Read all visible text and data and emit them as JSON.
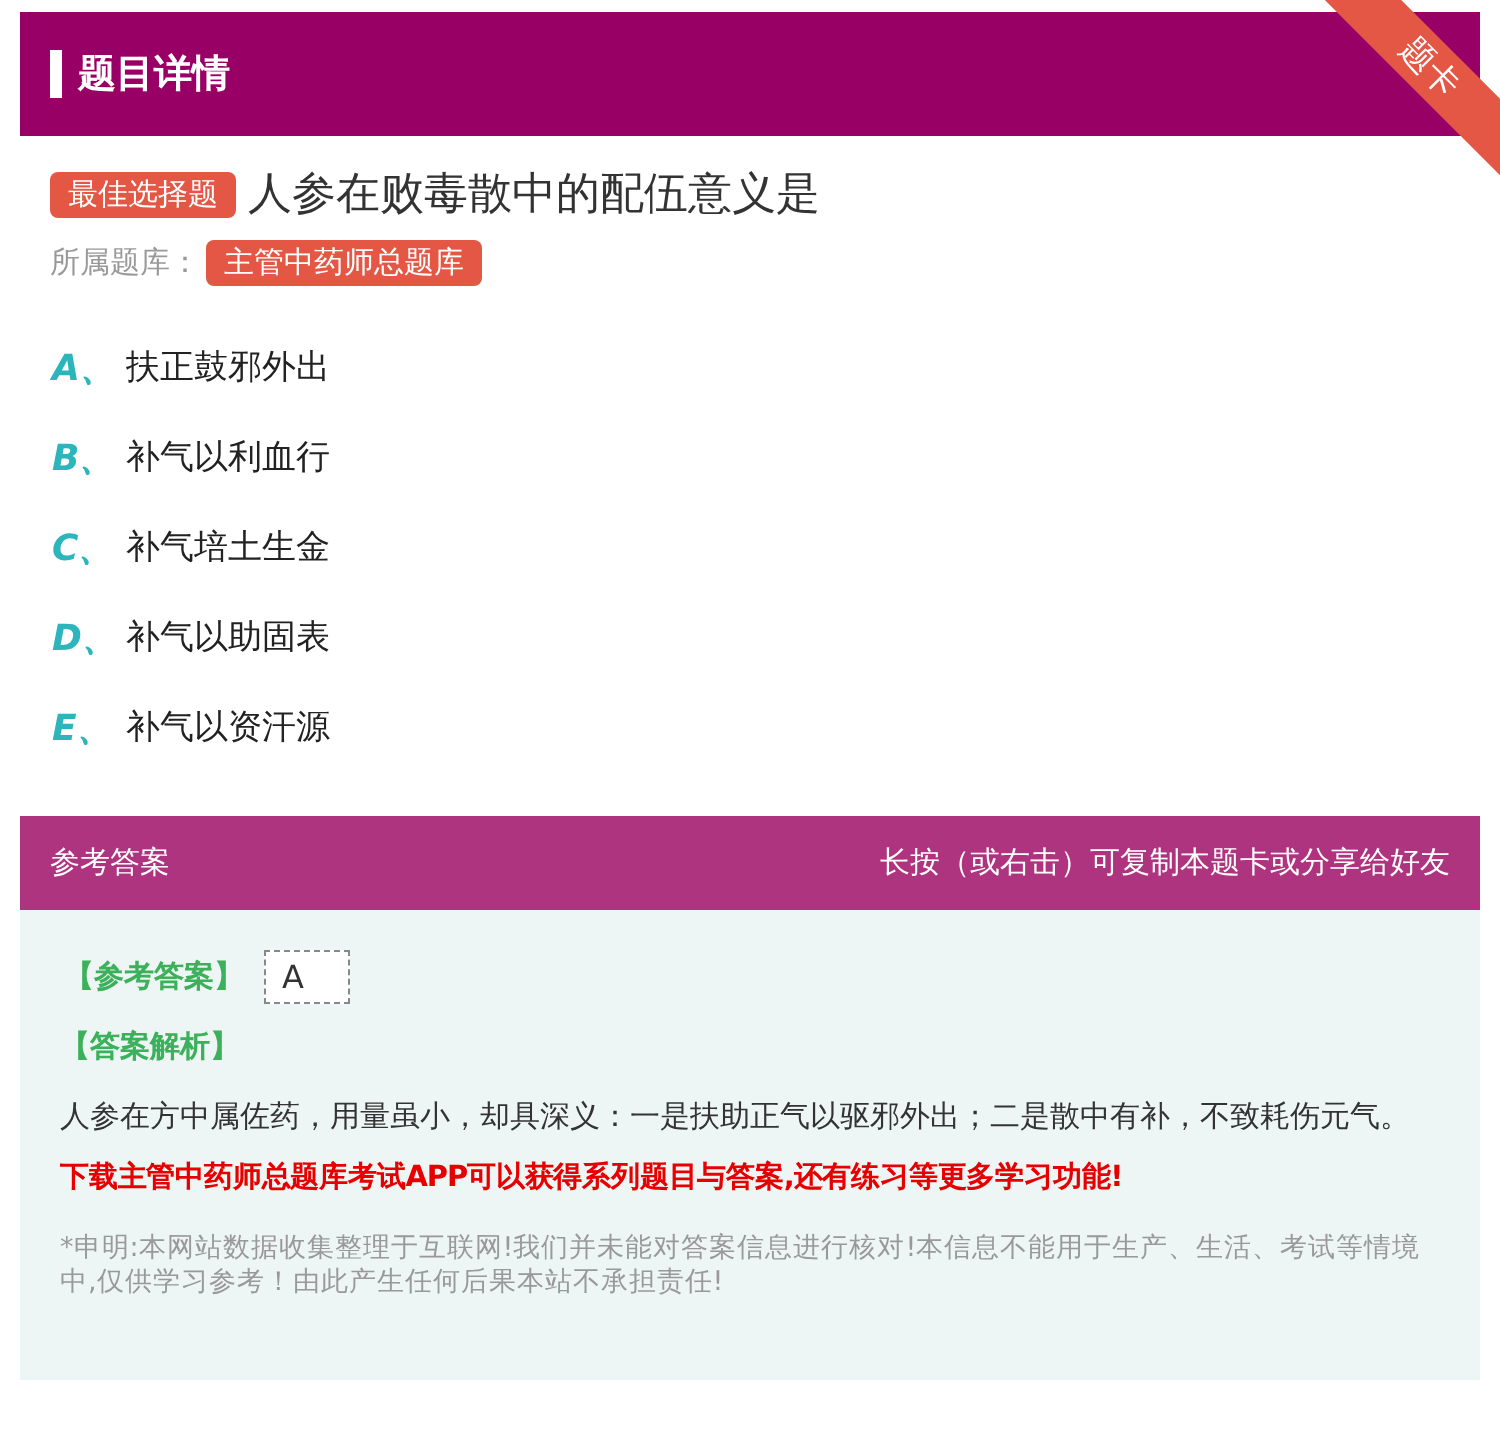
{
  "header": {
    "title": "题目详情",
    "ribbon": "题卡"
  },
  "question": {
    "type_badge": "最佳选择题",
    "text": "人参在败毒散中的配伍意义是",
    "bank_label": "所属题库：",
    "bank": "主管中药师总题库"
  },
  "options": [
    {
      "letter": "A、",
      "text": "扶正鼓邪外出"
    },
    {
      "letter": "B、",
      "text": "补气以利血行"
    },
    {
      "letter": "C、",
      "text": "补气培土生金"
    },
    {
      "letter": "D、",
      "text": "补气以助固表"
    },
    {
      "letter": "E、",
      "text": "补气以资汗源"
    }
  ],
  "answer_bar": {
    "title": "参考答案",
    "hint": "长按（或右击）可复制本题卡或分享给好友"
  },
  "answer": {
    "label": "【参考答案】",
    "value": "A",
    "analysis_label": "【答案解析】",
    "analysis": "人参在方中属佐药，用量虽小，却具深义：一是扶助正气以驱邪外出；二是散中有补，不致耗伤元气。",
    "promo": "下载主管中药师总题库考试APP可以获得系列题目与答案,还有练习等更多学习功能!",
    "disclaimer": "*申明:本网站数据收集整理于互联网!我们并未能对答案信息进行核对!本信息不能用于生产、生活、考试等情境中,仅供学习参考！由此产生任何后果本站不承担责任!"
  }
}
